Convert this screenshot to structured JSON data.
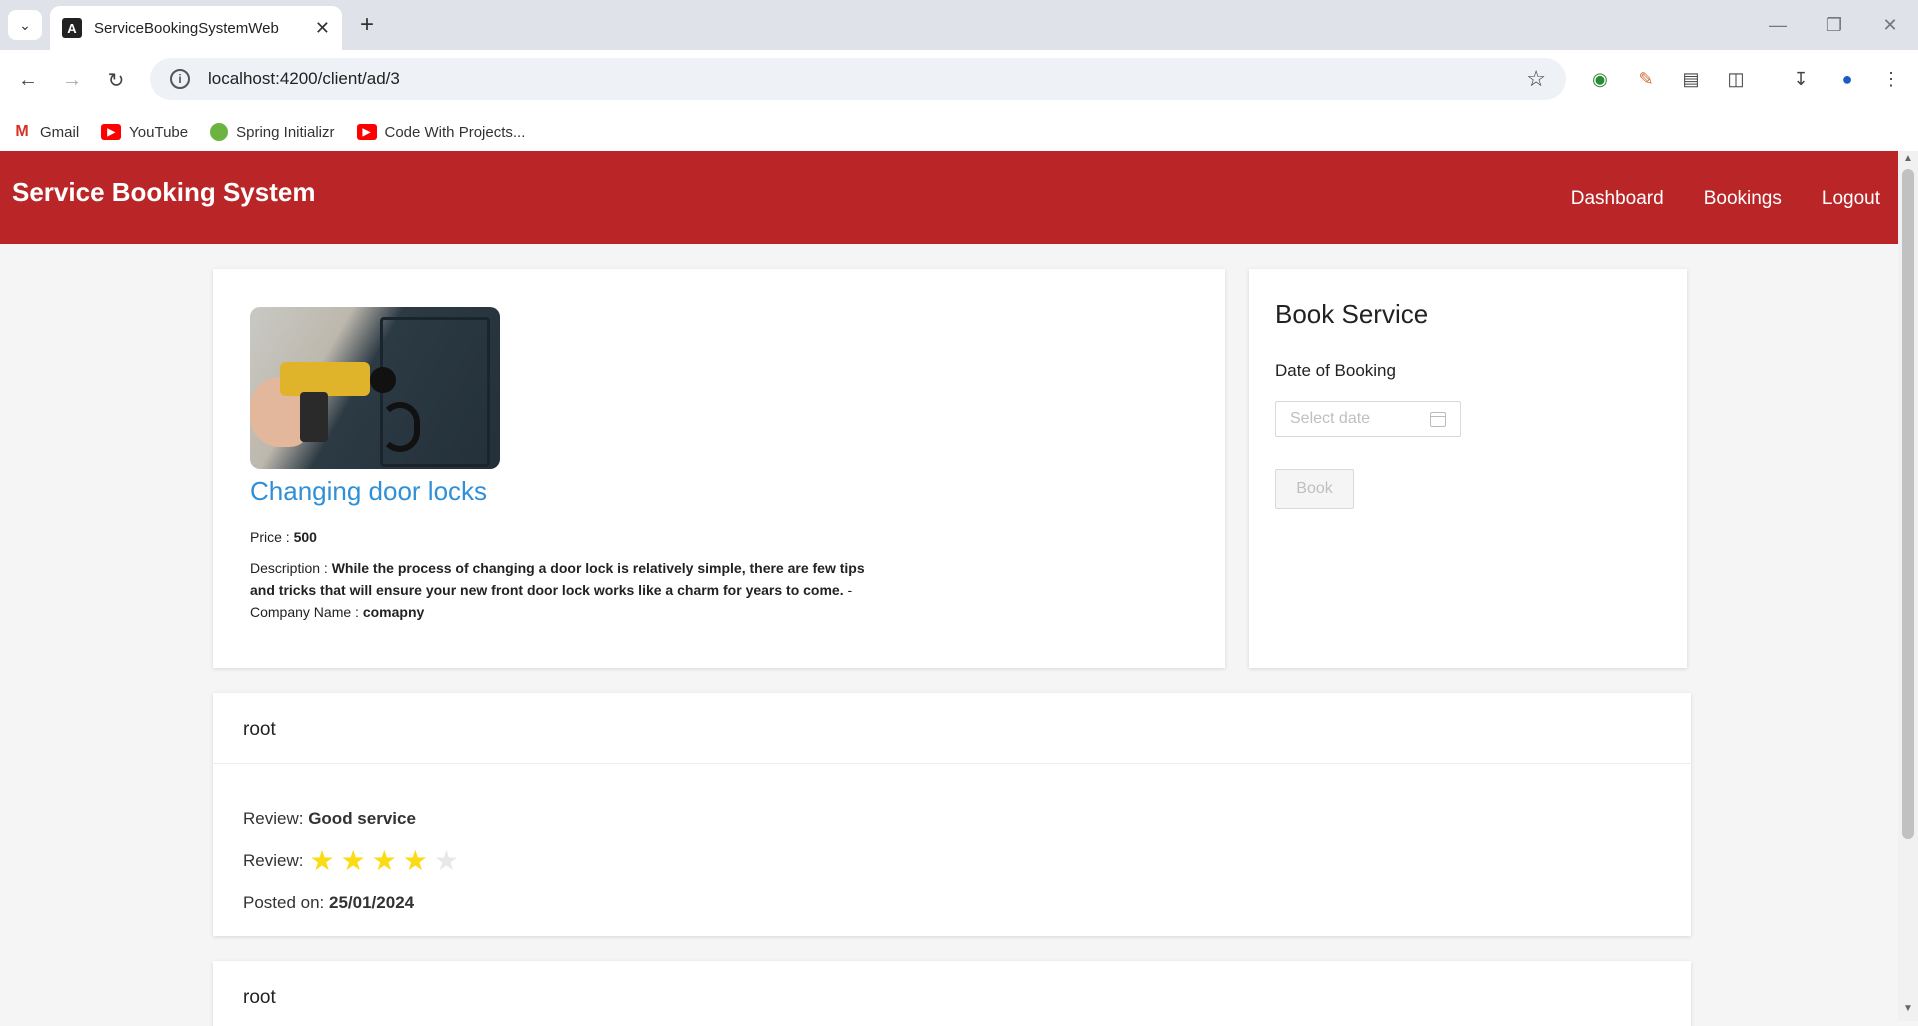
{
  "browser": {
    "tab_title": "ServiceBookingSystemWeb",
    "url": "localhost:4200/client/ad/3",
    "bookmarks": [
      {
        "label": "Gmail",
        "icon": "gmail-icon"
      },
      {
        "label": "YouTube",
        "icon": "youtube-icon"
      },
      {
        "label": "Spring Initializr",
        "icon": "spring-icon"
      },
      {
        "label": "Code With Projects...",
        "icon": "youtube-icon"
      }
    ]
  },
  "header": {
    "brand": "Service Booking System",
    "nav": [
      "Dashboard",
      "Bookings",
      "Logout"
    ],
    "color": "#ba2628"
  },
  "ad": {
    "title": "Changing door locks",
    "price_label": "Price :",
    "price": "500",
    "description_label": "Description :",
    "description": "While the process of changing a door lock is relatively simple, there are few tips and tricks that will ensure your new front door lock works like a charm for years to come.",
    "company_label": "- Company Name :",
    "company": "comapny",
    "title_color": "#2f8fd8"
  },
  "booking": {
    "title": "Book Service",
    "date_label": "Date of Booking",
    "date_placeholder": "Select date",
    "button_label": "Book"
  },
  "reviews": [
    {
      "user": "root",
      "review_label": "Review:",
      "review_text": "Good service",
      "rating_label": "Review:",
      "rating": 4,
      "rating_max": 5,
      "posted_label": "Posted on:",
      "posted_date": "25/01/2024"
    },
    {
      "user": "root"
    }
  ]
}
